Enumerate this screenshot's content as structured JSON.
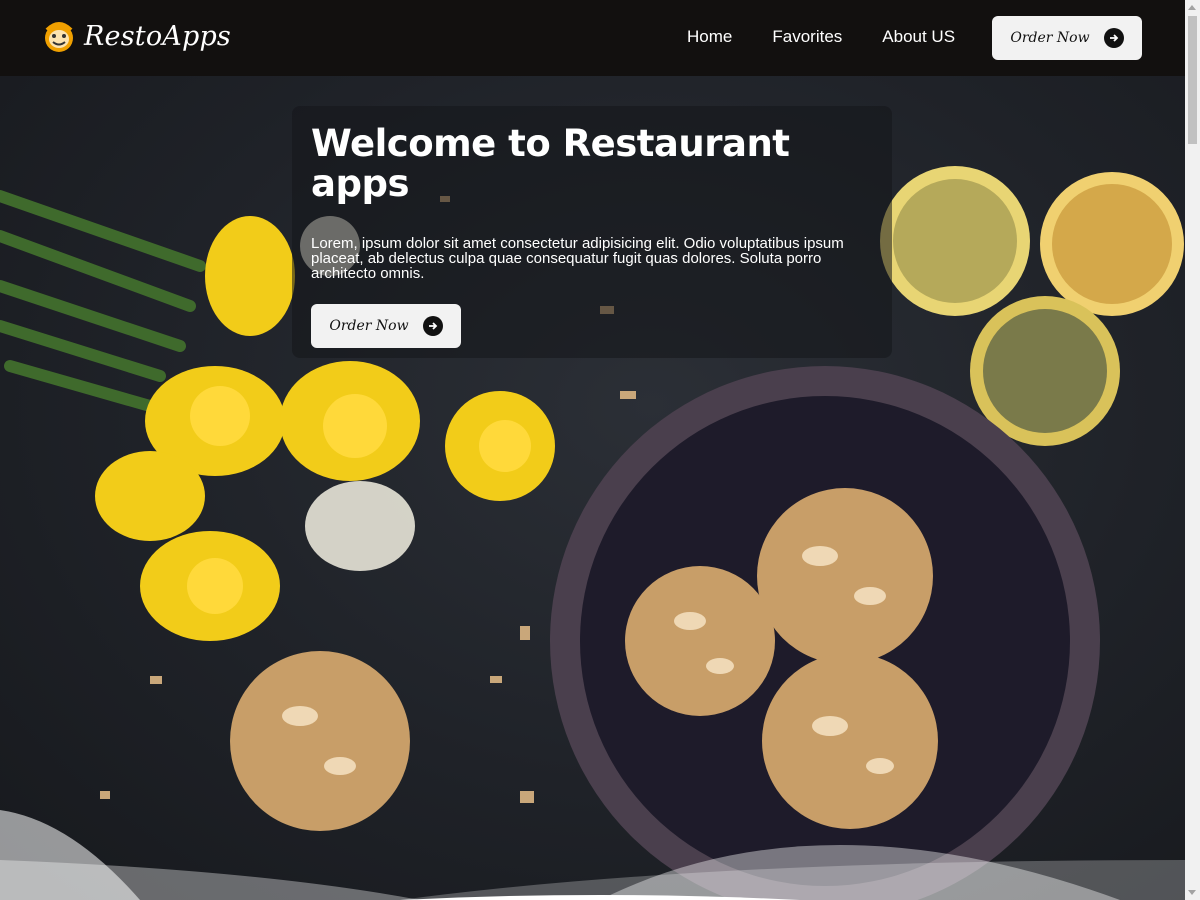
{
  "brand": {
    "name": "RestoApps",
    "logo_icon": "smiley-chef-icon",
    "accent": "#f0a000"
  },
  "nav": {
    "links": [
      "Home",
      "Favorites",
      "About US"
    ],
    "order_label": "Order Now",
    "order_icon": "arrow-right-circle-icon"
  },
  "hero": {
    "title": "Welcome to Restaurant apps",
    "description": "Lorem, ipsum dolor sit amet consectetur adipisicing elit. Odio voluptatibus ipsum placeat, ab delectus culpa quae consequatur fugit quas dolores. Soluta porro architecto omnis.",
    "order_label": "Order Now",
    "order_icon": "arrow-right-circle-icon",
    "background_image": "food-table-photo"
  },
  "colors": {
    "navbar": "#12100f",
    "button_bg": "#f2f2f2",
    "text": "#ffffff"
  }
}
